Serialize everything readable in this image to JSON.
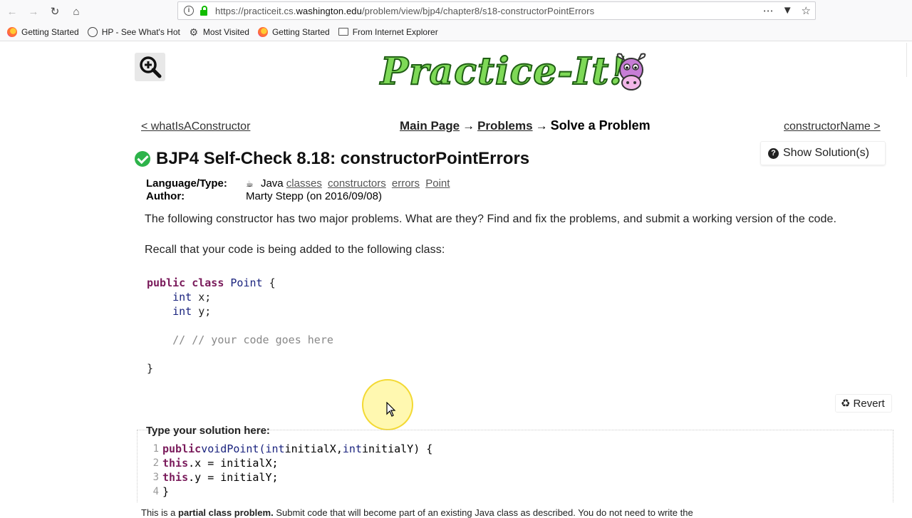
{
  "browser": {
    "url_prefix": "https://practiceit.cs.",
    "url_domain": "washington.edu",
    "url_path": "/problem/view/bjp4/chapter8/s18-constructorPointErrors",
    "bookmarks": [
      {
        "label": "Getting Started",
        "icon": "firefox-icon"
      },
      {
        "label": "HP - See What's Hot",
        "icon": "globe-icon"
      },
      {
        "label": "Most Visited",
        "icon": "gear-icon"
      },
      {
        "label": "Getting Started",
        "icon": "firefox-icon"
      },
      {
        "label": "From Internet Explorer",
        "icon": "folder-icon"
      }
    ]
  },
  "logo": {
    "text": "Practice-It!"
  },
  "nav": {
    "prev": "< whatIsAConstructor",
    "next": "constructorName >",
    "main_page": "Main Page",
    "arrow": "→",
    "problems": "Problems",
    "current": "Solve a Problem"
  },
  "buttons": {
    "show_solutions": "Show Solution(s)",
    "revert": "Revert"
  },
  "problem": {
    "title": "BJP4 Self-Check 8.18: constructorPointErrors",
    "language_label": "Language/Type:",
    "language": "Java",
    "tags": [
      "classes",
      "constructors",
      "errors",
      "Point"
    ],
    "author_label": "Author:",
    "author": "Marty Stepp (on 2016/09/08)",
    "description": "The following constructor has two major problems. What are they? Find and fix the problems, and submit a working version of the code.",
    "recall": "Recall that your code is being added to the following class:"
  },
  "class_code": {
    "l1_kw1": "public",
    "l1_kw2": "class",
    "l1_name": "Point",
    "l1_brace": "{",
    "l2_type": "int",
    "l2_rest": "x;",
    "l3_type": "int",
    "l3_rest": "y;",
    "l5_comment": "// // your code goes here",
    "l7_brace": "}"
  },
  "solution": {
    "label": "Type your solution here:",
    "lines": [
      {
        "n": "1",
        "kw": "public",
        "t1": "void",
        "name": "Point(",
        "t2": "int",
        "p1": "initialX,",
        "t3": "int",
        "p2": "initialY) {"
      },
      {
        "n": "2",
        "kw": "this",
        "rest": ".x = initialX;"
      },
      {
        "n": "3",
        "kw": "this",
        "rest": ".y = initialY;"
      },
      {
        "n": "4",
        "rest": "}"
      }
    ],
    "partial_prefix": "This is a",
    "partial_bold": "partial class problem.",
    "partial_rest": "Submit code that will become part of an existing Java class as described. You do not need to write the"
  }
}
